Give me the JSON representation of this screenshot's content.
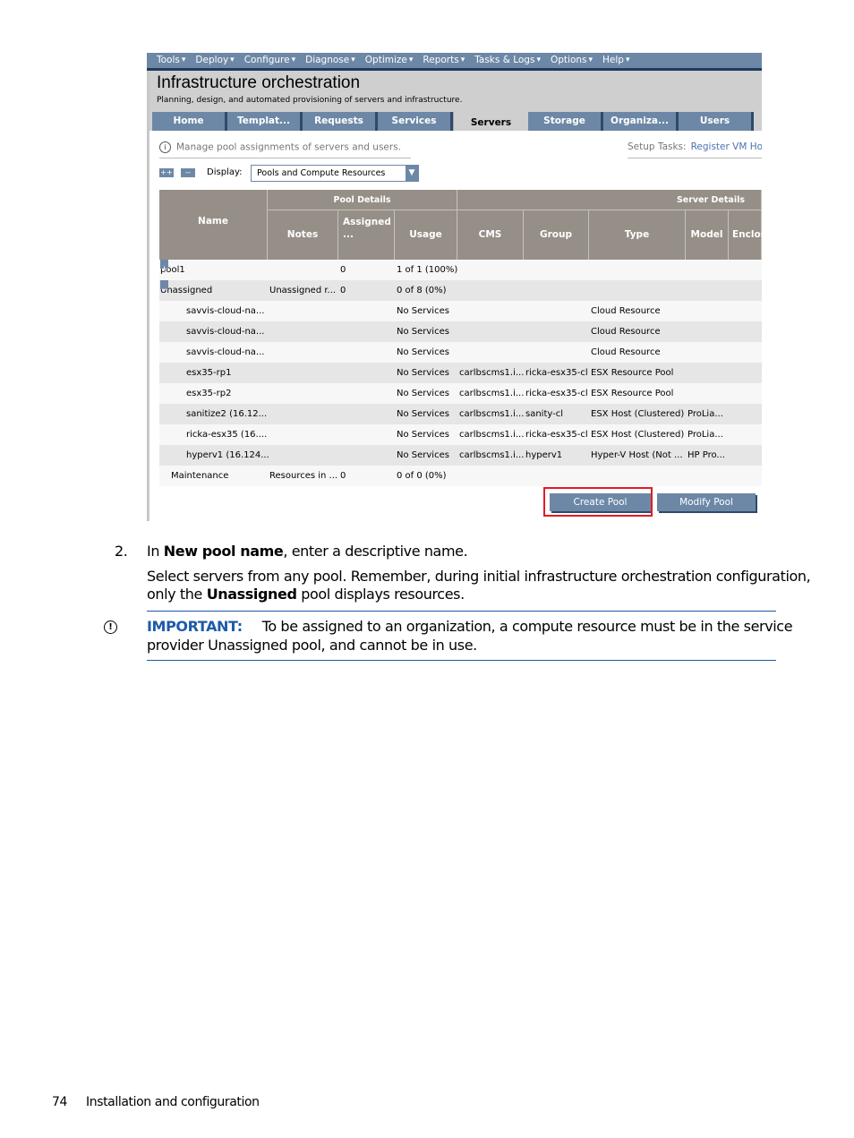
{
  "screenshot": {
    "menu": [
      "Tools",
      "Deploy",
      "Configure",
      "Diagnose",
      "Optimize",
      "Reports",
      "Tasks & Logs",
      "Options",
      "Help"
    ],
    "title": "Infrastructure orchestration",
    "subtitle": "Planning, design, and automated provisioning of servers and infrastructure.",
    "tabs": [
      "Home",
      "Templat...",
      "Requests",
      "Services",
      "Servers",
      "Storage",
      "Organiza...",
      "Users"
    ],
    "active_tab": "Servers",
    "info_text": "Manage pool assignments of servers and users.",
    "setup_label": "Setup Tasks:",
    "setup_link": "Register VM Ho",
    "expand_all": "++",
    "collapse_all": "--",
    "display_label": "Display:",
    "display_value": "Pools and Compute Resources",
    "group_headers": {
      "pool": "Pool Details",
      "server": "Server Details"
    },
    "columns": [
      "Name",
      "Notes",
      "Assigned ...",
      "Usage",
      "CMS",
      "Group",
      "Type",
      "Model",
      "Enclos"
    ],
    "rows": [
      {
        "expander": "+",
        "name": "pool1",
        "notes": "",
        "assigned": "0",
        "usage": "1 of 1 (100%)",
        "cms": "",
        "group": "",
        "type": "",
        "model": ""
      },
      {
        "expander": "-",
        "name": "Unassigned",
        "notes": "Unassigned r...",
        "assigned": "0",
        "usage": "0 of 8 (0%)",
        "cms": "",
        "group": "",
        "type": "",
        "model": ""
      },
      {
        "name": "savvis-cloud-na...",
        "notes": "",
        "assigned": "",
        "usage": "No Services",
        "cms": "",
        "group": "",
        "type": "Cloud Resource",
        "model": ""
      },
      {
        "name": "savvis-cloud-na...",
        "notes": "",
        "assigned": "",
        "usage": "No Services",
        "cms": "",
        "group": "",
        "type": "Cloud Resource",
        "model": ""
      },
      {
        "name": "savvis-cloud-na...",
        "notes": "",
        "assigned": "",
        "usage": "No Services",
        "cms": "",
        "group": "",
        "type": "Cloud Resource",
        "model": ""
      },
      {
        "name": "esx35-rp1",
        "notes": "",
        "assigned": "",
        "usage": "No Services",
        "cms": "carlbscms1.i...",
        "group": "ricka-esx35-cl",
        "type": "ESX Resource Pool",
        "model": ""
      },
      {
        "name": "esx35-rp2",
        "notes": "",
        "assigned": "",
        "usage": "No Services",
        "cms": "carlbscms1.i...",
        "group": "ricka-esx35-cl",
        "type": "ESX Resource Pool",
        "model": ""
      },
      {
        "name": "sanitize2 (16.12...",
        "notes": "",
        "assigned": "",
        "usage": "No Services",
        "cms": "carlbscms1.i...",
        "group": "sanity-cl",
        "type": "ESX Host (Clustered)",
        "model": "ProLia..."
      },
      {
        "name": "ricka-esx35 (16....",
        "notes": "",
        "assigned": "",
        "usage": "No Services",
        "cms": "carlbscms1.i...",
        "group": "ricka-esx35-cl",
        "type": "ESX Host (Clustered)",
        "model": "ProLia..."
      },
      {
        "name": "hyperv1 (16.124...",
        "notes": "",
        "assigned": "",
        "usage": "No Services",
        "cms": "carlbscms1.i...",
        "group": "hyperv1",
        "type": "Hyper-V Host (Not ...",
        "model": "HP Pro..."
      },
      {
        "name": "Maintenance",
        "notes": "Resources in ...",
        "assigned": "0",
        "usage": "0 of 0 (0%)",
        "cms": "",
        "group": "",
        "type": "",
        "model": ""
      }
    ],
    "create_pool": "Create Pool",
    "modify_pool": "Modify Pool",
    "highlight_color": "#e31b23"
  },
  "step": {
    "number": "2.",
    "pre": "In ",
    "bold": "New pool name",
    "post": ", enter a descriptive name.",
    "para_line1": "Select servers from any pool. Remember, during initial infrastructure orchestration configuration,",
    "para_pre": "only the ",
    "para_bold": "Unassigned",
    "para_post": " pool displays resources."
  },
  "important": {
    "label": "IMPORTANT:",
    "line1": "To be assigned to an organization, a compute resource must be in the service",
    "line2": "provider Unassigned pool, and cannot be in use."
  },
  "footer": {
    "page_number": "74",
    "section": "Installation and configuration"
  }
}
